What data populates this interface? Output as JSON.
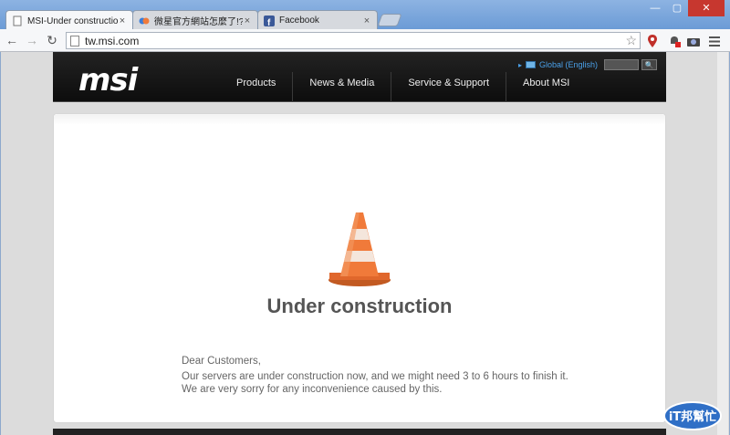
{
  "browser": {
    "tabs": [
      {
        "title": "MSI-Under construction",
        "active": true
      },
      {
        "title": "微星官方網站怎麼了!? - iT",
        "active": false
      },
      {
        "title": "Facebook",
        "active": false
      }
    ],
    "address": "tw.msi.com",
    "window_buttons": {
      "minimize": "—",
      "maximize": "▢",
      "close": "✕"
    }
  },
  "site": {
    "logo": "msi",
    "nav": [
      "Products",
      "News & Media",
      "Service & Support",
      "About MSI"
    ],
    "region": "Global (English)"
  },
  "content": {
    "heading": "Under construction",
    "greeting": "Dear Customers,",
    "line1": "Our servers are under construction now, and we might need 3 to 6 hours to finish it.",
    "line2": "We are very sorry for any inconvenience caused by this."
  },
  "watermark": "iT邦幫忙",
  "colors": {
    "accent": "#4aa0e8",
    "cone": "#f07a3a",
    "header": "#111111"
  }
}
